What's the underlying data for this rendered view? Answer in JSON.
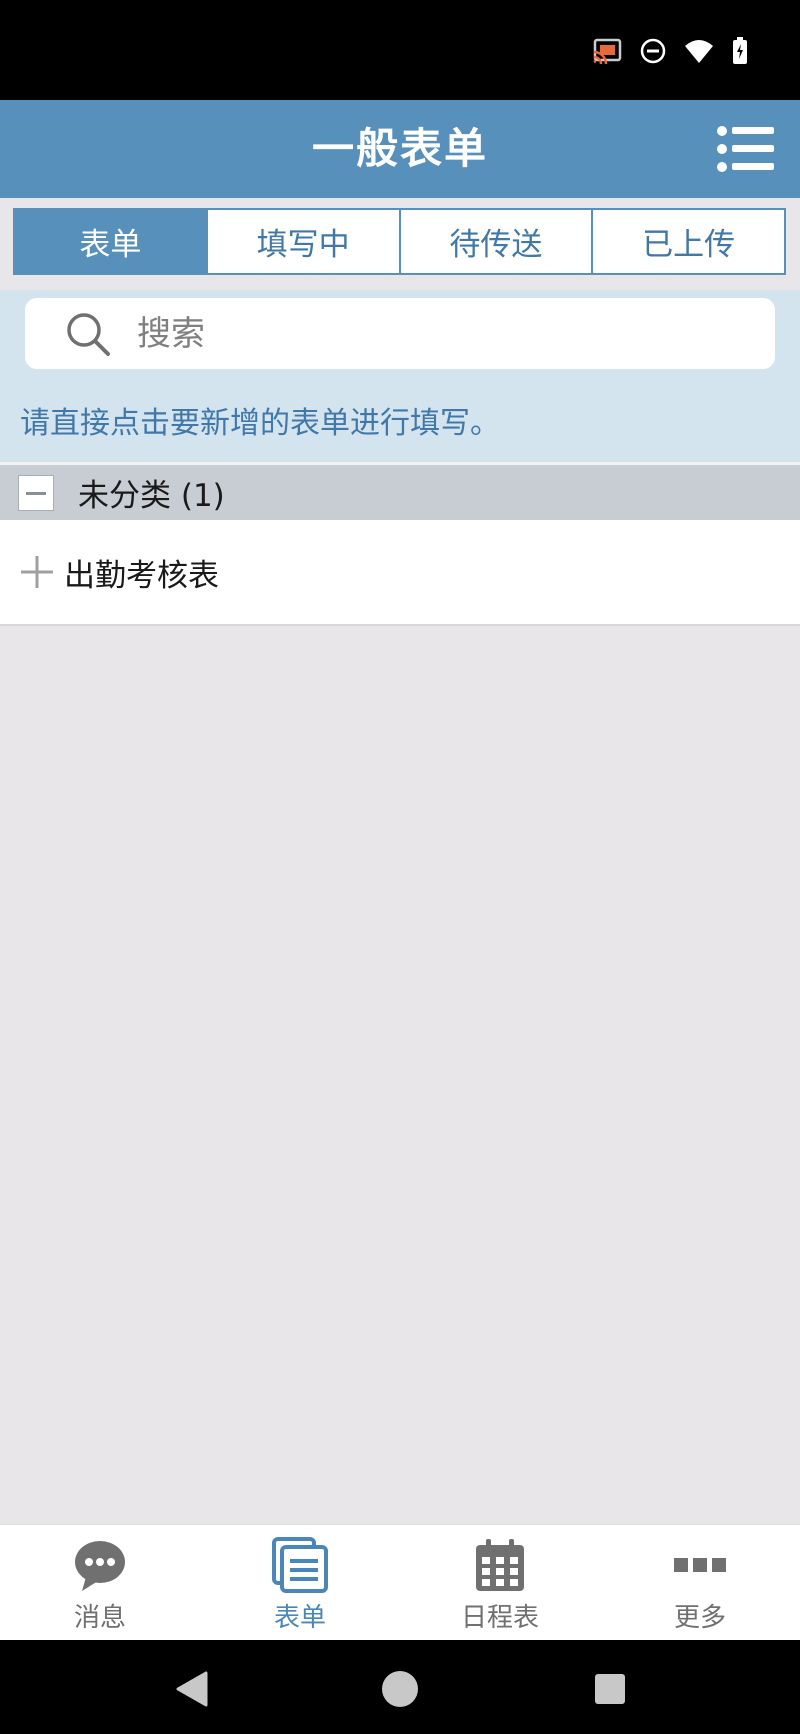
{
  "app": {
    "title": "一般表单"
  },
  "tabs": [
    {
      "label": "表单",
      "active": true
    },
    {
      "label": "填写中",
      "active": false
    },
    {
      "label": "待传送",
      "active": false
    },
    {
      "label": "已上传",
      "active": false
    }
  ],
  "search": {
    "placeholder": "搜索",
    "value": ""
  },
  "hint": "请直接点击要新增的表单进行填写。",
  "category": {
    "label": "未分类 (1)",
    "icon": "collapse-icon"
  },
  "forms": [
    {
      "label": "出勤考核表",
      "icon": "plus-icon"
    }
  ],
  "bottom_nav": [
    {
      "label": "消息",
      "icon": "chat-bubble-icon",
      "active": false
    },
    {
      "label": "表单",
      "icon": "forms-icon",
      "active": true
    },
    {
      "label": "日程表",
      "icon": "calendar-icon",
      "active": false
    },
    {
      "label": "更多",
      "icon": "more-icon",
      "active": false
    }
  ],
  "status_bar": {
    "icons": [
      "cast-icon",
      "do-not-disturb-icon",
      "wifi-icon",
      "battery-charging-icon"
    ]
  },
  "colors": {
    "primary": "#5790bb",
    "hint_text": "#3f78a9",
    "search_bg": "#d4e4ef",
    "category_bg": "#c8ccd3",
    "page_bg": "#e8e6e8"
  }
}
